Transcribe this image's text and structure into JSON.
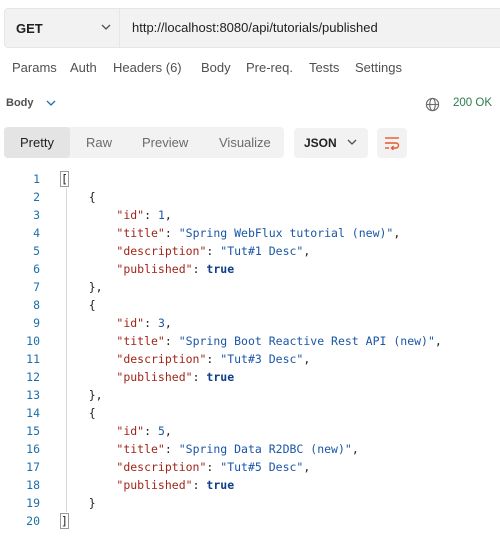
{
  "request": {
    "method": "GET",
    "url": "http://localhost:8080/api/tutorials/published"
  },
  "tabs": [
    {
      "label": "Params"
    },
    {
      "label": "Auth"
    },
    {
      "label": "Headers (6)"
    },
    {
      "label": "Body"
    },
    {
      "label": "Pre-req."
    },
    {
      "label": "Tests"
    },
    {
      "label": "Settings"
    }
  ],
  "response": {
    "section_label": "Body",
    "status": "200 OK",
    "icons": {
      "globe": "globe-icon",
      "wrap": "wrap-lines-icon",
      "chevron": "chevron-down-icon"
    }
  },
  "view": {
    "tabs": [
      {
        "label": "Pretty"
      },
      {
        "label": "Raw"
      },
      {
        "label": "Preview"
      },
      {
        "label": "Visualize"
      }
    ],
    "active_tab": "Pretty",
    "format": "JSON"
  },
  "code": {
    "line_numbers": [
      "1",
      "2",
      "3",
      "4",
      "5",
      "6",
      "7",
      "8",
      "9",
      "10",
      "11",
      "12",
      "13",
      "14",
      "15",
      "16",
      "17",
      "18",
      "19",
      "20"
    ],
    "items": [
      {
        "id": "1",
        "title": "\"Spring WebFlux tutorial (new)\"",
        "description": "\"Tut#1 Desc\"",
        "published": "true"
      },
      {
        "id": "3",
        "title": "\"Spring Boot Reactive Rest API (new)\"",
        "description": "\"Tut#3 Desc\"",
        "published": "true"
      },
      {
        "id": "5",
        "title": "\"Spring Data R2DBC (new)\"",
        "description": "\"Tut#5 Desc\"",
        "published": "true"
      }
    ],
    "keys": {
      "id": "\"id\"",
      "title": "\"title\"",
      "description": "\"description\"",
      "published": "\"published\""
    }
  },
  "colors": {
    "key": "#a0251a",
    "string": "#1a56a8",
    "boolean": "#0e3d8a",
    "status_ok": "#2c7a4d",
    "wrap_accent": "#e8572b"
  }
}
